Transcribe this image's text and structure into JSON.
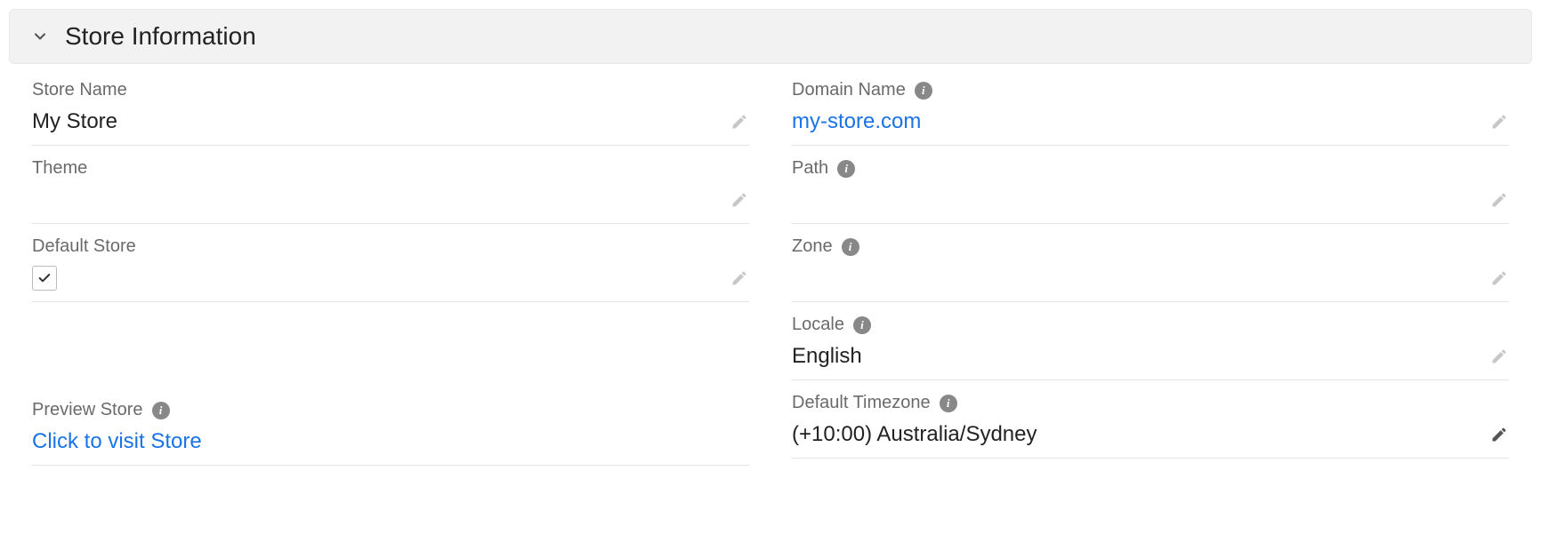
{
  "section": {
    "title": "Store Information"
  },
  "left": {
    "store_name": {
      "label": "Store Name",
      "value": "My Store"
    },
    "theme": {
      "label": "Theme",
      "value": ""
    },
    "default_store": {
      "label": "Default Store",
      "checked": true
    },
    "preview_store": {
      "label": "Preview Store",
      "link_text": "Click to visit Store"
    }
  },
  "right": {
    "domain_name": {
      "label": "Domain Name",
      "value": "my-store.com"
    },
    "path": {
      "label": "Path",
      "value": ""
    },
    "zone": {
      "label": "Zone",
      "value": ""
    },
    "locale": {
      "label": "Locale",
      "value": "English"
    },
    "default_timezone": {
      "label": "Default Timezone",
      "value": "(+10:00) Australia/Sydney"
    }
  }
}
